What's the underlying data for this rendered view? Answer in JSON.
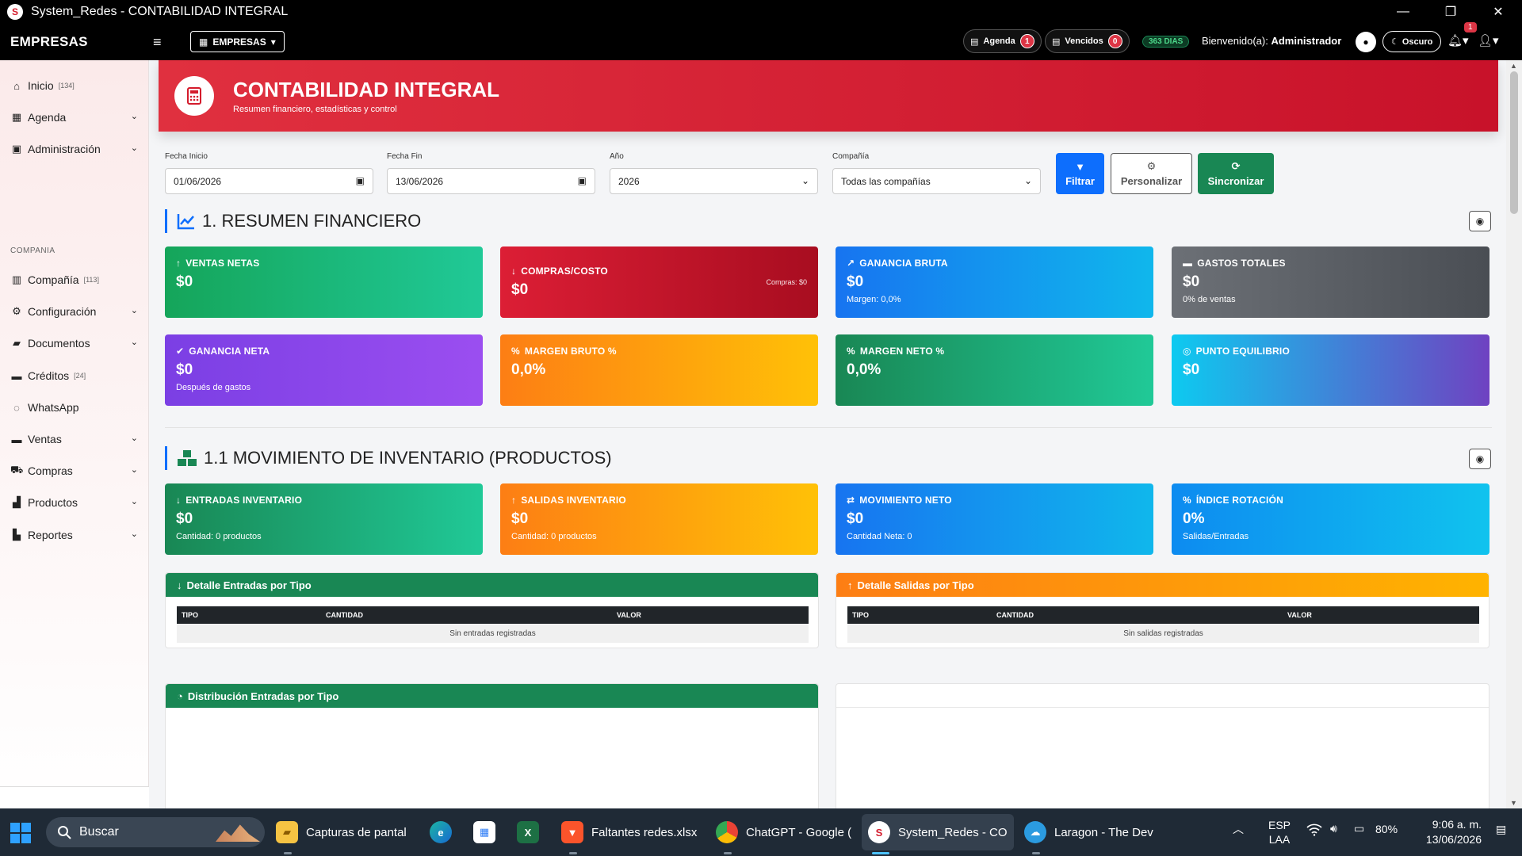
{
  "window": {
    "title": "System_Redes - CONTABILIDAD INTEGRAL",
    "minimize": "—",
    "maximize": "❐",
    "close": "✕"
  },
  "navbar": {
    "brand": "EMPRESAS",
    "empresas_btn": "EMPRESAS",
    "agenda_label": "Agenda",
    "agenda_count": "1",
    "vencidos_label": "Vencidos",
    "vencidos_count": "0",
    "days": "363 DIAS",
    "welcome_prefix": "Bienvenido(a):",
    "welcome_user": "Administrador",
    "dark_label": "Oscuro",
    "bell_count": "1"
  },
  "sidebar": {
    "items": [
      {
        "label": "Inicio",
        "count": "[134]"
      },
      {
        "label": "Agenda"
      },
      {
        "label": "Administración"
      },
      {
        "label": "Compañía",
        "count": "[113]"
      },
      {
        "label": "Configuración"
      },
      {
        "label": "Documentos"
      },
      {
        "label": "Créditos",
        "count": "[24]"
      },
      {
        "label": "WhatsApp"
      },
      {
        "label": "Ventas"
      },
      {
        "label": "Compras"
      },
      {
        "label": "Productos"
      },
      {
        "label": "Reportes"
      }
    ],
    "section_label": "COMPANIA"
  },
  "header": {
    "title": "CONTABILIDAD INTEGRAL",
    "subtitle": "Resumen financiero, estadísticas y control"
  },
  "filters": {
    "fecha_inicio_label": "Fecha Inicio",
    "fecha_inicio": "01/06/2026",
    "fecha_fin_label": "Fecha Fin",
    "fecha_fin": "13/06/2026",
    "anio_label": "Año",
    "anio": "2026",
    "compania_label": "Compañía",
    "compania": "Todas las compañías",
    "filtrar": "Filtrar",
    "personalizar": "Personalizar",
    "sincronizar": "Sincronizar"
  },
  "section1": {
    "title": "1. RESUMEN FINANCIERO",
    "cards": [
      {
        "title": "VENTAS NETAS",
        "value": "$0"
      },
      {
        "title": "COMPRAS/COSTO",
        "value": "$0",
        "right": "Compras: $0"
      },
      {
        "title": "GANANCIA BRUTA",
        "value": "$0",
        "sub": "Margen: 0,0%"
      },
      {
        "title": "GASTOS TOTALES",
        "value": "$0",
        "sub": "0% de ventas"
      },
      {
        "title": "GANANCIA NETA",
        "value": "$0",
        "sub": "Después de gastos"
      },
      {
        "title": "MARGEN BRUTO %",
        "value": "0,0%"
      },
      {
        "title": "MARGEN NETO %",
        "value": "0,0%"
      },
      {
        "title": "PUNTO EQUILIBRIO",
        "value": "$0"
      }
    ]
  },
  "section11": {
    "title": "1.1 MOVIMIENTO DE INVENTARIO (PRODUCTOS)",
    "cards": [
      {
        "title": "ENTRADAS INVENTARIO",
        "value": "$0",
        "sub": "Cantidad: 0 productos"
      },
      {
        "title": "SALIDAS INVENTARIO",
        "value": "$0",
        "sub": "Cantidad: 0 productos"
      },
      {
        "title": "MOVIMIENTO NETO",
        "value": "$0",
        "sub": "Cantidad Neta: 0"
      },
      {
        "title": "ÍNDICE ROTACIÓN",
        "value": "0%",
        "sub": "Salidas/Entradas"
      }
    ],
    "entradas": {
      "title": "Detalle Entradas por Tipo",
      "cols": [
        "TIPO",
        "CANTIDAD",
        "VALOR"
      ],
      "empty": "Sin entradas registradas"
    },
    "salidas": {
      "title": "Detalle Salidas por Tipo",
      "cols": [
        "TIPO",
        "CANTIDAD",
        "VALOR"
      ],
      "empty": "Sin salidas registradas"
    },
    "distribucion": {
      "title": "Distribución Entradas por Tipo"
    }
  },
  "taskbar": {
    "search": "Buscar",
    "apps": [
      {
        "label": "Capturas de pantal"
      },
      {
        "label": "Faltantes redes.xlsx"
      },
      {
        "label": "ChatGPT - Google ("
      },
      {
        "label": "System_Redes - CO"
      },
      {
        "label": "Laragon - The Dev"
      }
    ],
    "lang1": "ESP",
    "lang2": "LAA",
    "battery": "80%",
    "time": "9:06 a. m.",
    "date": "13/06/2026"
  },
  "colors": {
    "accent_red": "#d41b2c",
    "primary_blue": "#0d6efd",
    "success_green": "#198754",
    "warning_orange": "#fd7e14"
  }
}
